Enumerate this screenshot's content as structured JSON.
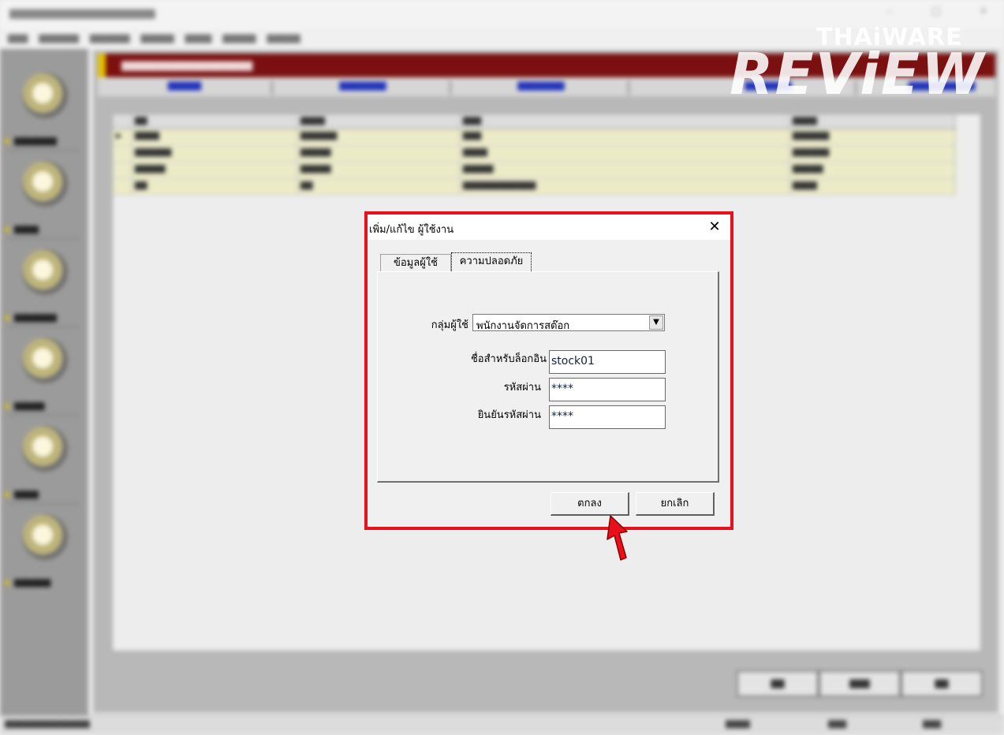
{
  "watermark": {
    "top": "THAiWARE",
    "bottom": "REViEW"
  },
  "dialog": {
    "title": "เพิ่ม/แก้ไข ผู้ใช้งาน",
    "tabs": [
      {
        "label": "ข้อมูลผู้ใช้",
        "active": false
      },
      {
        "label": "ความปลอดภัย",
        "active": true
      }
    ],
    "user_group": {
      "label": "กลุ่มผู้ใช้",
      "value": "พนักงานจัดการสต๊อก"
    },
    "login": {
      "label": "ชื่อสำหรับล็อกอิน",
      "value": "stock01"
    },
    "password": {
      "label": "รหัสผ่าน",
      "value": "****"
    },
    "confirm_password": {
      "label": "ยินยันรหัสผ่าน",
      "value": "****"
    },
    "ok_label": "ตกลง",
    "cancel_label": "ยกเลิก"
  },
  "colors": {
    "highlight": "#e8101a",
    "header_bar": "#7b1010",
    "grid_row": "#ecebc8"
  }
}
